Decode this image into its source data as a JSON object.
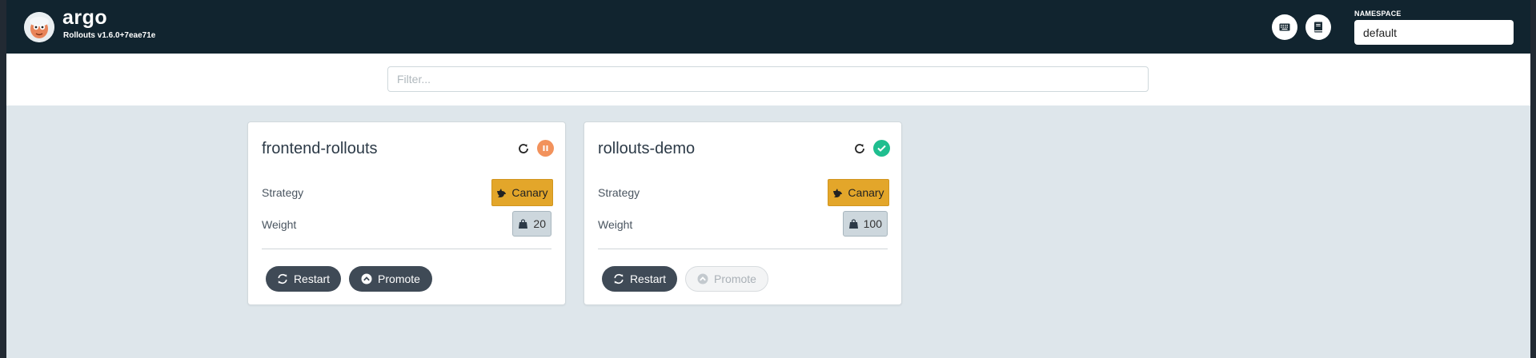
{
  "header": {
    "brand_name": "argo",
    "brand_version": "Rollouts v1.6.0+7eae71e",
    "keyboard_icon": "keyboard-icon",
    "docs_icon": "book-icon",
    "namespace_label": "NAMESPACE",
    "namespace_value": "default"
  },
  "filter": {
    "placeholder": "Filter..."
  },
  "rollouts": [
    {
      "name": "frontend-rollouts",
      "status": "paused",
      "status_color": "#f2925c",
      "strategy_label": "Strategy",
      "strategy_value": "Canary",
      "weight_label": "Weight",
      "weight_value": "20",
      "restart_label": "Restart",
      "promote_label": "Promote",
      "promote_enabled": true
    },
    {
      "name": "rollouts-demo",
      "status": "healthy",
      "status_color": "#1fbe8f",
      "strategy_label": "Strategy",
      "strategy_value": "Canary",
      "weight_label": "Weight",
      "weight_value": "100",
      "restart_label": "Restart",
      "promote_label": "Promote",
      "promote_enabled": false
    }
  ],
  "colors": {
    "header_bg": "#11242f",
    "canary": "#e3a62a",
    "button_dark": "#3f4a56",
    "page_bg": "#dee6eb"
  }
}
